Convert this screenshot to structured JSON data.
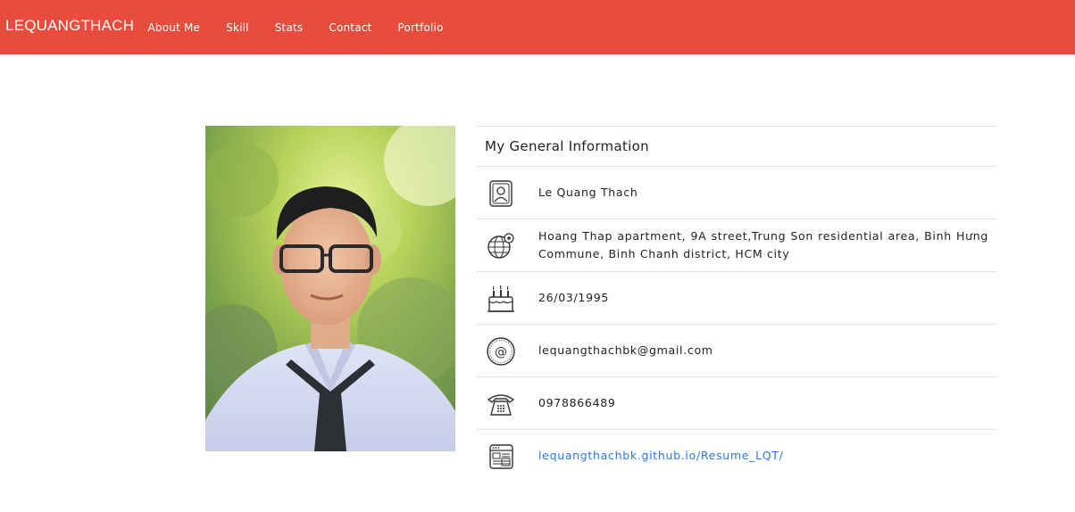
{
  "navbar": {
    "brand": "LEQUANGTHACH",
    "links": [
      "About Me",
      "Skill",
      "Stats",
      "Contact",
      "Portfolio"
    ],
    "background": "#e74c3c"
  },
  "profile": {
    "photo_alt": "profile-photo"
  },
  "info": {
    "title": "My General Information",
    "rows": [
      {
        "icon": "user-badge-icon",
        "text": "Le Quang Thach"
      },
      {
        "icon": "globe-location-icon",
        "text": "Hoang Thap apartment, 9A street,Trung Son residential area, Binh Hưng Commune, Binh Chanh district, HCM city"
      },
      {
        "icon": "birthday-cake-icon",
        "text": "26/03/1995"
      },
      {
        "icon": "email-at-icon",
        "text": "lequangthachbk@gmail.com"
      },
      {
        "icon": "telephone-icon",
        "text": "0978866489"
      },
      {
        "icon": "website-icon",
        "text": "lequangthachbk.github.io/Resume_LQT/"
      }
    ],
    "link_color": "#2a7ae2"
  }
}
